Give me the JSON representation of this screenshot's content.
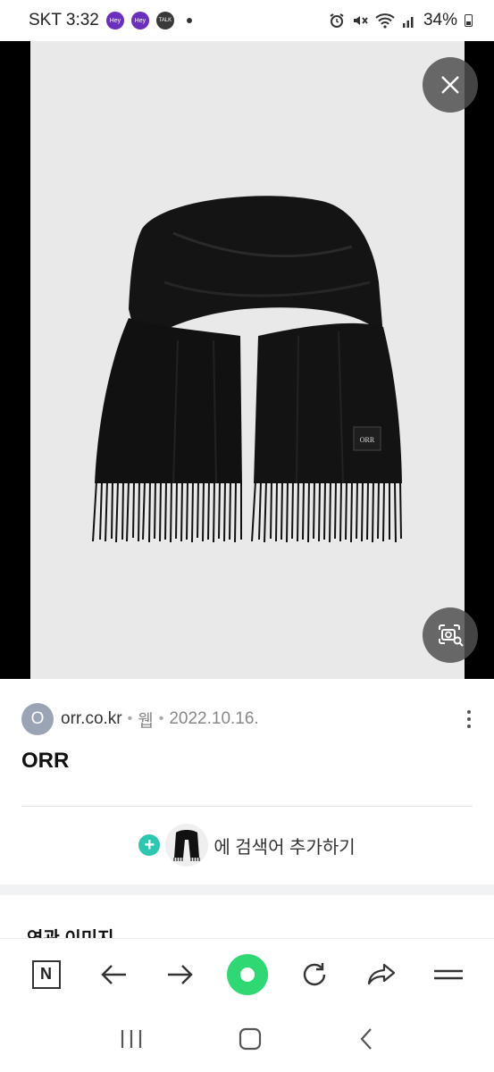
{
  "status_bar": {
    "carrier_time": "SKT 3:32",
    "notifications": [
      {
        "icon": "app-notification-icon",
        "text": "Hey"
      },
      {
        "icon": "app-notification-icon",
        "text": "Hey"
      },
      {
        "icon": "kakaotalk-icon",
        "text": "TALK"
      }
    ],
    "battery": "34%",
    "icons": [
      "alarm-icon",
      "mute-icon",
      "wifi-icon",
      "signal-icon",
      "battery-icon"
    ]
  },
  "viewer": {
    "background": "#000000",
    "image_description": "black scarf with fringe",
    "patch_text": "ORR",
    "close_icon": "close-icon",
    "lens_icon": "image-search-icon"
  },
  "result": {
    "avatar_letter": "O",
    "domain": "orr.co.kr",
    "separator": "•",
    "type": "웹",
    "date": "2022.10.16.",
    "title": "ORR",
    "add_search_label": "에 검색어 추가하기"
  },
  "related": {
    "title": "연관 이미지"
  },
  "toolbar": {
    "items": [
      "naver-home-icon",
      "back-arrow-icon",
      "forward-arrow-icon",
      "green-dot-icon",
      "refresh-icon",
      "share-icon",
      "menu-icon"
    ],
    "home_letter": "N",
    "accent": "#2ed873"
  },
  "system_nav": [
    "recent-apps-icon",
    "home-icon",
    "back-icon"
  ]
}
